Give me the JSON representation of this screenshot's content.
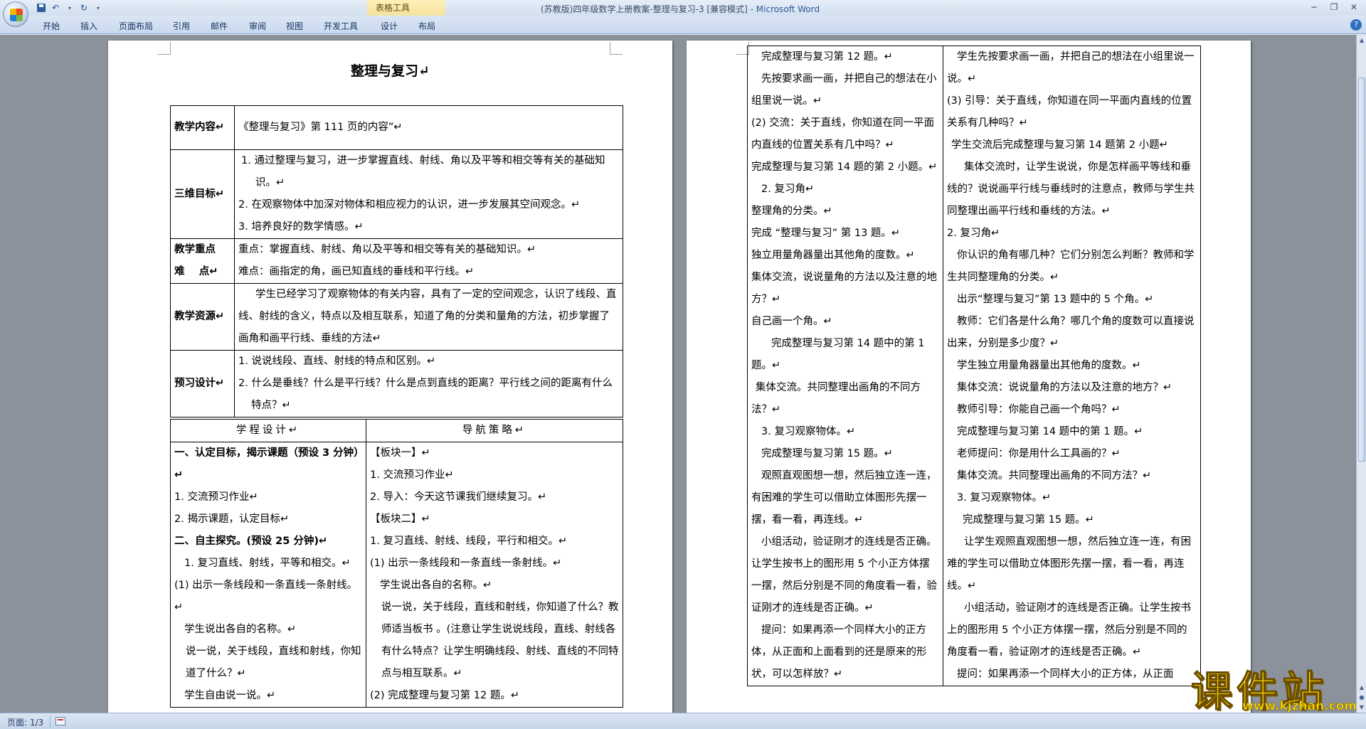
{
  "window": {
    "title_prefix": "(苏教版)四年级数学上册教案-整理与复习-3 [兼容模式] - ",
    "app_name": "Microsoft Word",
    "context_tab_group": "表格工具"
  },
  "ribbon": {
    "tabs": [
      "开始",
      "插入",
      "页面布局",
      "引用",
      "邮件",
      "审阅",
      "视图",
      "开发工具",
      "设计",
      "布局"
    ]
  },
  "status": {
    "page": "页面: 1/3"
  },
  "page1": {
    "title": "整理与复习↵",
    "rows": [
      {
        "label": "教学内容↵",
        "lines": [
          "《整理与复习》第 111 页的内容”↵"
        ]
      },
      {
        "label": "三维目标↵",
        "lines": [
          "1. 通过整理与复习，进一步掌握直线、射线、角以及平等和相交等有关的基础知识。↵",
          "2. 在观察物体中加深对物体和相应视力的认识，进一步发展其空间观念。↵",
          "3. 培养良好的数学情感。↵"
        ]
      },
      {
        "label1": "教学重点",
        "label2": "难    点↵",
        "lines": [
          "重点：掌握直线、射线、角以及平等和相交等有关的基础知识。↵",
          "难点：画指定的角，画已知直线的垂线和平行线。↵"
        ]
      },
      {
        "label": "教学资源↵",
        "lines": [
          "学生已经学习了观察物体的有关内容，具有了一定的空间观念，认识了线段、直线、射线的含义，特点以及相互联系，知道了角的分类和量角的方法，初步掌握了画角和画平行线、垂线的方法↵"
        ]
      },
      {
        "label": "预习设计↵",
        "lines": [
          "1. 说说线段、直线、射线的特点和区别。↵",
          "2. 什么是垂线？什么是平行线？什么是点到直线的距离？平行线之间的距离有什么特点？↵"
        ]
      }
    ],
    "head_left": "学程设计↵",
    "head_right": "导航策略↵",
    "left_col": [
      "一、认定目标，揭示课题（预设 3 分钟）↵",
      "1. 交流预习作业↵",
      "2. 揭示课题，认定目标↵",
      "二、自主探究。(预设 25 分钟)↵",
      "1. 复习直线、射线，平等和相交。↵",
      "(1)  出示一条线段和一条直线一条射线。↵",
      "学生说出各自的名称。↵",
      "说一说，关于线段，直线和射线，你知道了什么？↵",
      "学生自由说一说。↵"
    ],
    "right_col": [
      "【板块一】↵",
      "1. 交流预习作业↵",
      "2. 导入：今天这节课我们继续复习。↵",
      "【板块二】↵",
      "1. 复习直线、射线、线段，平行和相交。↵",
      "(1)  出示一条线段和一条直线一条射线。↵",
      "学生说出各自的名称。↵",
      "说一说，关于线段，直线和射线，你知道了什么？教师适当板书 。(注意让学生说说线段，直线、射线各有什么特点？让学生明确线段、射线、直线的不同特点与相互联系。↵",
      "(2) 完成整理与复习第 12 题。↵"
    ]
  },
  "page2": {
    "left_col": [
      "完成整理与复习第 12 题。↵",
      "先按要求画一画，并把自己的想法在小组里说一说。↵",
      "(2) 交流：关于直线，你知道在同一平面内直线的位置关系有几中吗？↵",
      "完成整理与复习第 14 题的第 2 小题。↵",
      "2. 复习角↵",
      "整理角的分类。↵",
      "完成 “整理与复习” 第 13 题。↵",
      "独立用量角器量出其他角的度数。↵",
      "集体交流，说说量角的方法以及注意的地方？↵",
      "自己画一个角。↵",
      "完成整理与复习第 14 题中的第 1 题。↵",
      "集体交流。共同整理出画角的不同方法？↵",
      "3. 复习观察物体。↵",
      "完成整理与复习第 15 题。↵",
      "观照直观图想一想，然后独立连一连，有困难的学生可以借助立体图形先摆一摆，看一看，再连线。↵",
      "小组活动，验证刚才的连线是否正确。让学生按书上的图形用 5 个小正方体摆一摆，然后分别是不同的角度看一看，验证刚才的连线是否正确。↵",
      "提问：如果再添一个同样大小的正方体，从正面和上面看到的还是原来的形状，可以怎样放？↵"
    ],
    "right_col": [
      "学生先按要求画一画，并把自己的想法在小组里说一说。↵",
      "(3) 引导：关于直线，你知道在同一平面内直线的位置关系有几种吗？↵",
      "学生交流后完成整理与复习第 14 题第 2 小题↵",
      "集体交流时，让学生说说，你是怎样画平等线和垂线的？说说画平行线与垂线时的注意点，教师与学生共同整理出画平行线和垂线的方法。↵",
      "2. 复习角↵",
      "你认识的角有哪几种？它们分别怎么判断？教师和学生共同整理角的分类。↵",
      "出示“整理与复习”第 13 题中的 5 个角。↵",
      "教师：它们各是什么角？哪几个角的度数可以直接说出来，分别是多少度？↵",
      "学生独立用量角器量出其他角的度数。↵",
      "集体交流：说说量角的方法以及注意的地方？↵",
      "教师引导：你能自己画一个角吗？↵",
      "完成整理与复习第 14 题中的第 1 题。↵",
      "老师提问：你是用什么工具画的？↵",
      "集体交流。共同整理出画角的不同方法？↵",
      "3. 复习观察物体。↵",
      "完成整理与复习第 15 题。↵",
      "让学生观照直观图想一想，然后独立连一连，有困难的学生可以借助立体图形先摆一摆，看一看，再连线。↵",
      "小组活动，验证刚才的连线是否正确。让学生按书上的图形用 5 个小正方体摆一摆，然后分别是不同的角度看一看，验证刚才的连线是否正确。↵",
      "提问：如果再添一个同样大小的正方体，从正面"
    ]
  },
  "watermark": {
    "name": "课件站",
    "url": "www.kjzhan.com"
  }
}
